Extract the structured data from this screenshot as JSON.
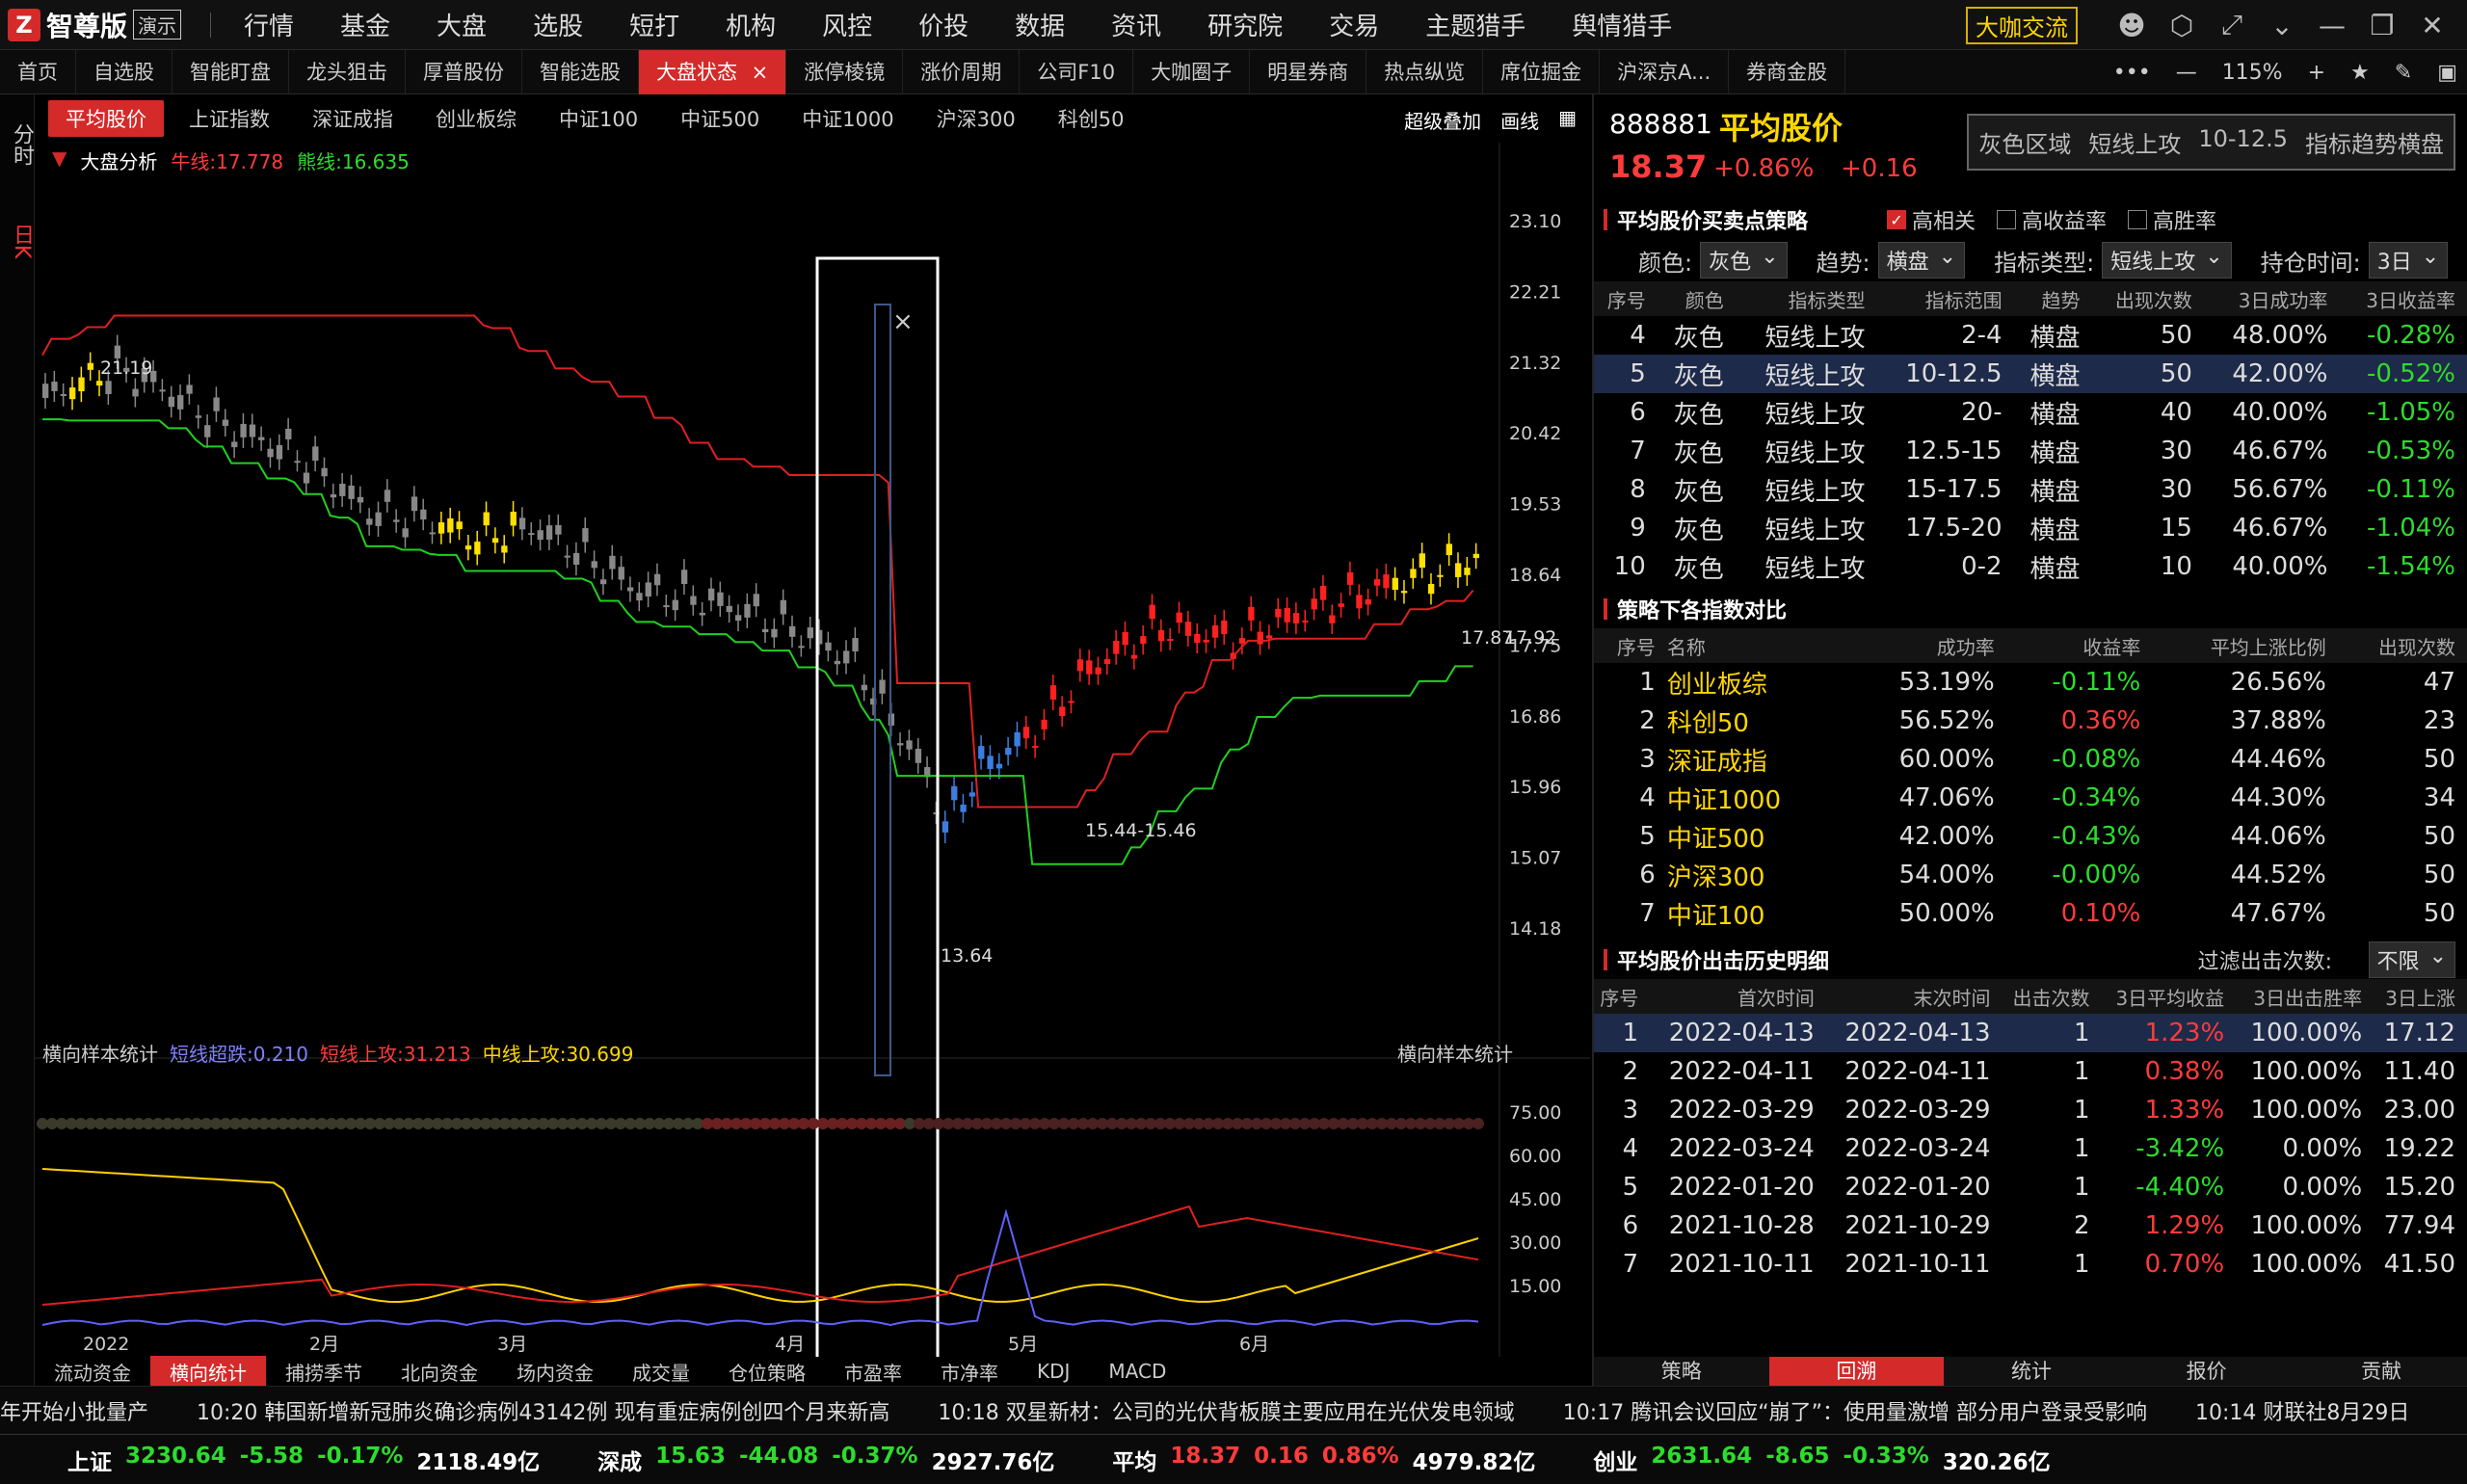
{
  "app": {
    "logo_text": "智尊版",
    "demo_label": "演示",
    "community_button": "大咖交流"
  },
  "menu": [
    "行情",
    "基金",
    "大盘",
    "选股",
    "短打",
    "机构",
    "风控",
    "价投",
    "数据",
    "资讯",
    "研究院",
    "交易",
    "主题猎手",
    "舆情猎手"
  ],
  "tabs": [
    {
      "label": "首页",
      "active": false
    },
    {
      "label": "自选股",
      "active": false
    },
    {
      "label": "智能盯盘",
      "active": false
    },
    {
      "label": "龙头狙击",
      "active": false
    },
    {
      "label": "厚普股份",
      "active": false
    },
    {
      "label": "智能选股",
      "active": false
    },
    {
      "label": "大盘状态",
      "active": true
    },
    {
      "label": "涨停棱镜",
      "active": false
    },
    {
      "label": "涨价周期",
      "active": false
    },
    {
      "label": "公司F10",
      "active": false
    },
    {
      "label": "大咖圈子",
      "active": false
    },
    {
      "label": "明星券商",
      "active": false
    },
    {
      "label": "热点纵览",
      "active": false
    },
    {
      "label": "席位掘金",
      "active": false
    },
    {
      "label": "沪深京A...",
      "active": false
    },
    {
      "label": "券商金股",
      "active": false
    }
  ],
  "zoom": "115%",
  "left_tabs": [
    "分时",
    "日K"
  ],
  "index_tabs": [
    {
      "label": "平均股价",
      "active": true
    },
    {
      "label": "上证指数",
      "active": false
    },
    {
      "label": "深证成指",
      "active": false
    },
    {
      "label": "创业板综",
      "active": false
    },
    {
      "label": "中证100",
      "active": false
    },
    {
      "label": "中证500",
      "active": false
    },
    {
      "label": "中证1000",
      "active": false
    },
    {
      "label": "沪深300",
      "active": false
    },
    {
      "label": "科创50",
      "active": false
    }
  ],
  "index_actions": {
    "overlay": "超级叠加",
    "draw": "画线"
  },
  "chart_info": {
    "title": "大盘分析",
    "bull": "牛线:17.778",
    "bear": "熊线:16.635"
  },
  "sub_info": {
    "name": "横向样本统计",
    "s1": "短线超跌:0.210",
    "s2": "短线上攻:31.213",
    "s3": "中线上攻:30.699",
    "right_label": "横向样本统计"
  },
  "chart_data": [
    {
      "type": "candlestick",
      "title": "大盘分析",
      "y_ticks": [
        "23.10",
        "22.21",
        "21.32",
        "20.42",
        "19.53",
        "18.64",
        "17.75",
        "16.86",
        "15.96",
        "15.07",
        "14.18"
      ],
      "x_ticks": [
        "2022",
        "2月",
        "3月",
        "4月",
        "5月",
        "6月"
      ],
      "annotations": [
        "21.19",
        "13.64",
        "15.44-15.46",
        "17.87",
        "17.92"
      ],
      "series": [
        {
          "name": "牛线",
          "values": [
            17.778
          ]
        },
        {
          "name": "熊线",
          "values": [
            16.635
          ]
        }
      ]
    },
    {
      "type": "line",
      "title": "横向样本统计",
      "y_ticks": [
        "75.00",
        "60.00",
        "45.00",
        "30.00",
        "15.00"
      ],
      "series": [
        {
          "name": "短线超跌",
          "last": 0.21
        },
        {
          "name": "短线上攻",
          "last": 31.213
        },
        {
          "name": "中线上攻",
          "last": 30.699
        }
      ]
    }
  ],
  "bottom_tabs": [
    {
      "label": "流动资金",
      "active": false
    },
    {
      "label": "横向统计",
      "active": true
    },
    {
      "label": "捕捞季节",
      "active": false
    },
    {
      "label": "北向资金",
      "active": false
    },
    {
      "label": "场内资金",
      "active": false
    },
    {
      "label": "成交量",
      "active": false
    },
    {
      "label": "仓位策略",
      "active": false
    },
    {
      "label": "市盈率",
      "active": false
    },
    {
      "label": "市净率",
      "active": false
    },
    {
      "label": "KDJ",
      "active": false
    },
    {
      "label": "MACD",
      "active": false
    }
  ],
  "right": {
    "code": "888881",
    "name": "平均股价",
    "price": "18.37",
    "chg_pct": "+0.86%",
    "chg": "+0.16",
    "status": [
      "灰色区域",
      "短线上攻",
      "10-12.5",
      "指标趋势横盘"
    ],
    "strategy_title": "平均股价买卖点策略",
    "checks": [
      {
        "label": "高相关",
        "on": true
      },
      {
        "label": "高收益率",
        "on": false
      },
      {
        "label": "高胜率",
        "on": false
      }
    ],
    "filters": {
      "color_label": "颜色:",
      "color": "灰色",
      "trend_label": "趋势:",
      "trend": "横盘",
      "type_label": "指标类型:",
      "type": "短线上攻",
      "hold_label": "持仓时间:",
      "hold": "3日"
    },
    "t1_headers": [
      "序号",
      "颜色",
      "指标类型",
      "指标范围",
      "趋势",
      "出现次数",
      "3日成功率",
      "3日收益率"
    ],
    "t1_rows": [
      [
        "4",
        "灰色",
        "短线上攻",
        "2-4",
        "横盘",
        "50",
        "48.00%",
        "-0.28%"
      ],
      [
        "5",
        "灰色",
        "短线上攻",
        "10-12.5",
        "横盘",
        "50",
        "42.00%",
        "-0.52%"
      ],
      [
        "6",
        "灰色",
        "短线上攻",
        "20-",
        "横盘",
        "40",
        "40.00%",
        "-1.05%"
      ],
      [
        "7",
        "灰色",
        "短线上攻",
        "12.5-15",
        "横盘",
        "30",
        "46.67%",
        "-0.53%"
      ],
      [
        "8",
        "灰色",
        "短线上攻",
        "15-17.5",
        "横盘",
        "30",
        "56.67%",
        "-0.11%"
      ],
      [
        "9",
        "灰色",
        "短线上攻",
        "17.5-20",
        "横盘",
        "15",
        "46.67%",
        "-1.04%"
      ],
      [
        "10",
        "灰色",
        "短线上攻",
        "0-2",
        "横盘",
        "10",
        "40.00%",
        "-1.54%"
      ]
    ],
    "t1_selected": 1,
    "cmp_title": "策略下各指数对比",
    "t2_headers": [
      "序号",
      "名称",
      "成功率",
      "收益率",
      "平均上涨比例",
      "出现次数"
    ],
    "t2_rows": [
      [
        "1",
        "创业板综",
        "53.19%",
        "-0.11%",
        "26.56%",
        "47"
      ],
      [
        "2",
        "科创50",
        "56.52%",
        "0.36%",
        "37.88%",
        "23"
      ],
      [
        "3",
        "深证成指",
        "60.00%",
        "-0.08%",
        "44.46%",
        "50"
      ],
      [
        "4",
        "中证1000",
        "47.06%",
        "-0.34%",
        "44.30%",
        "34"
      ],
      [
        "5",
        "中证500",
        "42.00%",
        "-0.43%",
        "44.06%",
        "50"
      ],
      [
        "6",
        "沪深300",
        "54.00%",
        "-0.00%",
        "44.52%",
        "50"
      ],
      [
        "7",
        "中证100",
        "50.00%",
        "0.10%",
        "47.67%",
        "50"
      ]
    ],
    "hist_title": "平均股价出击历史明细",
    "hist_filter_label": "过滤出击次数:",
    "hist_filter": "不限",
    "t3_headers": [
      "序号",
      "首次时间",
      "末次时间",
      "出击次数",
      "3日平均收益",
      "3日出击胜率",
      "3日上涨"
    ],
    "t3_rows": [
      [
        "1",
        "2022-04-13",
        "2022-04-13",
        "1",
        "1.23%",
        "100.00%",
        "17.12"
      ],
      [
        "2",
        "2022-04-11",
        "2022-04-11",
        "1",
        "0.38%",
        "100.00%",
        "11.40"
      ],
      [
        "3",
        "2022-03-29",
        "2022-03-29",
        "1",
        "1.33%",
        "100.00%",
        "23.00"
      ],
      [
        "4",
        "2022-03-24",
        "2022-03-24",
        "1",
        "-3.42%",
        "0.00%",
        "19.22"
      ],
      [
        "5",
        "2022-01-20",
        "2022-01-20",
        "1",
        "-4.40%",
        "0.00%",
        "15.20"
      ],
      [
        "6",
        "2021-10-28",
        "2021-10-29",
        "2",
        "1.29%",
        "100.00%",
        "77.94"
      ],
      [
        "7",
        "2021-10-11",
        "2021-10-11",
        "1",
        "0.70%",
        "100.00%",
        "41.50"
      ]
    ],
    "t3_selected": 0,
    "bottom_tabs": [
      {
        "label": "策略",
        "active": false
      },
      {
        "label": "回溯",
        "active": true
      },
      {
        "label": "统计",
        "active": false
      },
      {
        "label": "报价",
        "active": false
      },
      {
        "label": "贡献",
        "active": false
      }
    ]
  },
  "news": [
    "年开始小批量产",
    "10:20 韩国新增新冠肺炎确诊病例43142例 现有重症病例创四个月来新高",
    "10:18 双星新材：公司的光伏背板膜主要应用在光伏发电领域",
    "10:17 腾讯会议回应“崩了”：使用量激增 部分用户登录受影响",
    "10:14 财联社8月29日"
  ],
  "status": [
    {
      "name": "上证",
      "price": "3230.64",
      "chg": "-5.58",
      "pct": "-0.17%",
      "amt": "2118.49亿",
      "up": false
    },
    {
      "name": "深成",
      "price": "15.63",
      "chg": "-44.08",
      "pct": "-0.37%",
      "amt": "2927.76亿",
      "up": false
    },
    {
      "name": "平均",
      "price": "18.37",
      "chg": "0.16",
      "pct": "0.86%",
      "amt": "4979.82亿",
      "up": true
    },
    {
      "name": "创业",
      "price": "2631.64",
      "chg": "-8.65",
      "pct": "-0.33%",
      "amt": "320.26亿",
      "up": false
    }
  ],
  "colors": {
    "accent": "#d42a2a",
    "up": "#ff3b3b",
    "down": "#2ddc2d",
    "gold": "#ffd700"
  }
}
